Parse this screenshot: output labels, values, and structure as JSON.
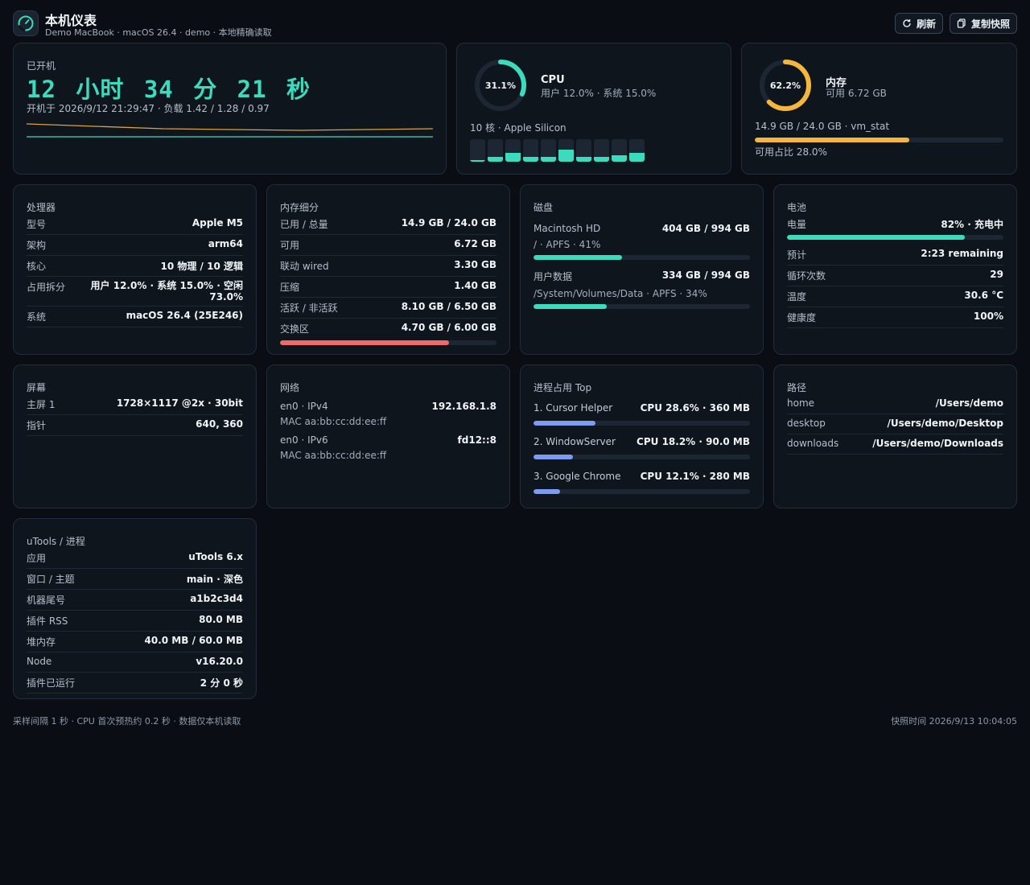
{
  "header": {
    "title": "本机仪表",
    "subtitle": "Demo MacBook · macOS 26.4 · demo · 本地精确读取",
    "icon": "speedometer-icon",
    "refresh_label": "刷新",
    "copy_label": "复制快照"
  },
  "uptime": {
    "label": "已开机",
    "value": "12 小时 34 分 21 秒",
    "since": "开机于 2026/9/12 21:29:47 · 负载 1.42 / 1.28 / 0.97"
  },
  "cpu_summary": {
    "percent_text": "31.1%",
    "percent": 31.1,
    "title": "CPU",
    "sub": "用户 12.0% · 系统 15.0%",
    "cores_label": "10 核 · Apple Silicon",
    "core_loads": [
      0.05,
      0.22,
      0.38,
      0.2,
      0.2,
      0.55,
      0.2,
      0.2,
      0.28,
      0.38
    ]
  },
  "mem_summary": {
    "percent_text": "62.2%",
    "percent": 62.2,
    "title": "内存",
    "sub": "可用 6.72 GB",
    "line": "14.9 GB / 24.0 GB · vm_stat",
    "bar": 0.622,
    "available": "可用占比 28.0%"
  },
  "cpu_detail": {
    "title": "处理器",
    "rows": [
      {
        "k": "型号",
        "v": "Apple M5"
      },
      {
        "k": "架构",
        "v": "arm64"
      },
      {
        "k": "核心",
        "v": "10 物理 / 10 逻辑"
      },
      {
        "k": "占用拆分",
        "v": "用户 12.0% · 系统 15.0% · 空闲 73.0%"
      },
      {
        "k": "系统",
        "v": "macOS 26.4 (25E246)"
      }
    ]
  },
  "mem_detail": {
    "title": "内存细分",
    "rows": [
      {
        "k": "已用 / 总量",
        "v": "14.9 GB / 24.0 GB"
      },
      {
        "k": "可用",
        "v": "6.72 GB"
      },
      {
        "k": "联动 wired",
        "v": "3.30 GB"
      },
      {
        "k": "压缩",
        "v": "1.40 GB"
      },
      {
        "k": "活跃 / 非活跃",
        "v": "8.10 GB / 6.50 GB"
      },
      {
        "k": "交换区",
        "v": "4.70 GB / 6.00 GB"
      }
    ],
    "swap_bar": 0.78,
    "swap_color": "#ef6b6b"
  },
  "disk": {
    "title": "磁盘",
    "items": [
      {
        "name": "Macintosh HD",
        "usage": "404 GB / 994 GB",
        "sub": "/ · APFS · 41%",
        "bar": 0.41
      },
      {
        "name": "用户数据",
        "usage": "334 GB / 994 GB",
        "sub": "/System/Volumes/Data · APFS · 34%",
        "bar": 0.34
      }
    ]
  },
  "battery": {
    "title": "电池",
    "charge_label": "电量",
    "charge_value": "82% · 充电中",
    "charge_bar": 0.82,
    "rows": [
      {
        "k": "预计",
        "v": "2:23 remaining"
      },
      {
        "k": "循环次数",
        "v": "29"
      },
      {
        "k": "温度",
        "v": "30.6 °C"
      },
      {
        "k": "健康度",
        "v": "100%"
      }
    ]
  },
  "screen": {
    "title": "屏幕",
    "rows": [
      {
        "k": "主屏 1",
        "v": "1728×1117 @2x · 30bit"
      },
      {
        "k": "指针",
        "v": "640, 360"
      }
    ]
  },
  "network": {
    "title": "网络",
    "items": [
      {
        "iface": "en0 · IPv4",
        "addr": "192.168.1.8",
        "mac": "MAC aa:bb:cc:dd:ee:ff"
      },
      {
        "iface": "en0 · IPv6",
        "addr": "fd12::8",
        "mac": "MAC aa:bb:cc:dd:ee:ff"
      }
    ]
  },
  "processes": {
    "title": "进程占用 Top",
    "items": [
      {
        "name": "1. Cursor Helper",
        "usage": "CPU 28.6% · 360 MB",
        "bar": 0.286
      },
      {
        "name": "2. WindowServer",
        "usage": "CPU 18.2% · 90.0 MB",
        "bar": 0.182
      },
      {
        "name": "3. Google Chrome",
        "usage": "CPU 12.1% · 280 MB",
        "bar": 0.121
      }
    ],
    "bar_color": "#7b9cf0"
  },
  "paths": {
    "title": "路径",
    "rows": [
      {
        "k": "home",
        "v": "/Users/demo"
      },
      {
        "k": "desktop",
        "v": "/Users/demo/Desktop"
      },
      {
        "k": "downloads",
        "v": "/Users/demo/Downloads"
      }
    ]
  },
  "utools": {
    "title": "uTools / 进程",
    "rows": [
      {
        "k": "应用",
        "v": "uTools 6.x"
      },
      {
        "k": "窗口 / 主题",
        "v": "main · 深色"
      },
      {
        "k": "机器尾号",
        "v": "a1b2c3d4"
      },
      {
        "k": "插件 RSS",
        "v": "80.0 MB"
      },
      {
        "k": "堆内存",
        "v": "40.0 MB / 60.0 MB"
      },
      {
        "k": "Node",
        "v": "v16.20.0"
      },
      {
        "k": "插件已运行",
        "v": "2 分 0 秒"
      }
    ]
  },
  "footer": {
    "left": "采样间隔 1 秒 · CPU 首次预热约 0.2 秒 · 数据仅本机读取",
    "right": "快照时间 2026/9/13 10:04:05"
  },
  "colors": {
    "accent": "#3ddbbe",
    "memory": "#f4b73e",
    "process": "#7b9cf0",
    "swap": "#ef6b6b",
    "background": "#0a0e14",
    "card": "#0f151d"
  }
}
